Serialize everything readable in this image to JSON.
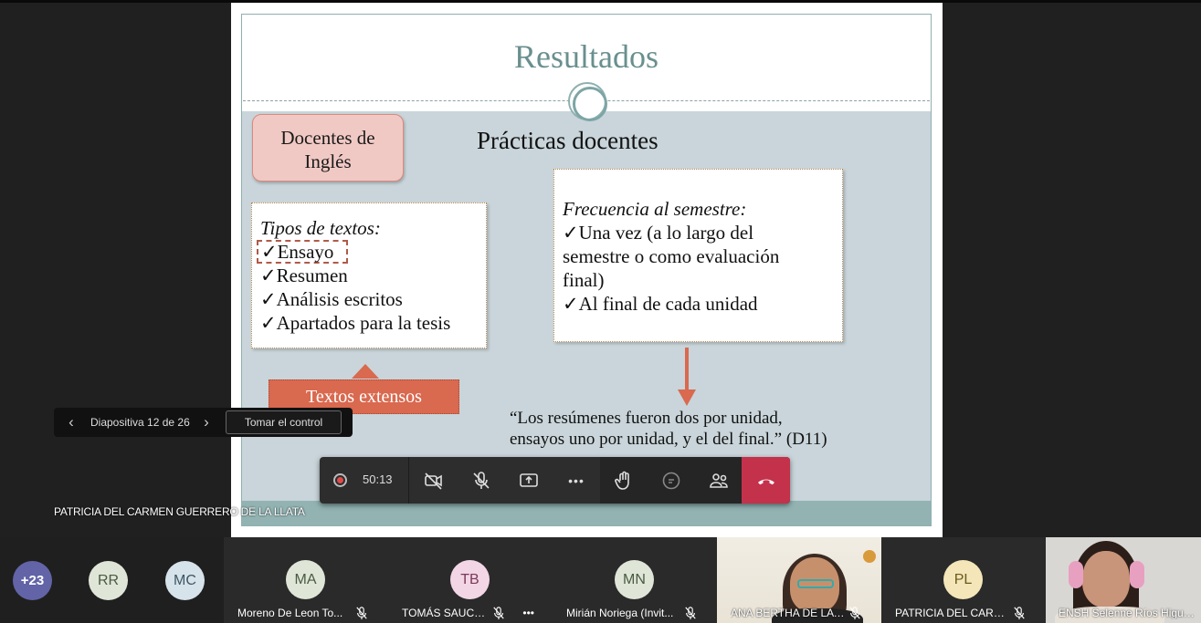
{
  "slide": {
    "title": "Resultados",
    "docentes_label_line1": "Docentes de",
    "docentes_label_line2": "Inglés",
    "practicas_title": "Prácticas docentes",
    "tipos": {
      "heading": "Tipos de textos:",
      "items": [
        "Ensayo",
        "Resumen",
        "Análisis escritos",
        "Apartados para la tesis"
      ]
    },
    "frecuencia": {
      "heading": "Frecuencia al semestre:",
      "item1_line1": "Una vez (a lo largo del",
      "item1_line2": "semestre o como evaluación",
      "item1_line3": "final)",
      "item2": "Al final de cada unidad"
    },
    "textos_extensos": "Textos extensos",
    "quote_line1": "“Los resúmenes fueron dos por unidad,",
    "quote_line2": "ensayos uno por unidad, y el del final.” (D11)",
    "check": "✓"
  },
  "slide_nav": {
    "prev_icon": "‹",
    "label": "Diapositiva 12 de 26",
    "next_icon": "›",
    "take_control": "Tomar el control"
  },
  "presenter_name": "PATRICIA DEL CARMEN GUERRERO DE LA LLATA",
  "controls": {
    "timer": "50:13",
    "more": "•••",
    "leave_color": "#c4314b",
    "record_color": "#e04a4a"
  },
  "participants": {
    "overflow": "+23",
    "avatars": [
      {
        "initials": "RR",
        "bg": "#dfe6d8",
        "fg": "#4a5a40"
      },
      {
        "initials": "MC",
        "bg": "#d7e3ea",
        "fg": "#3e5666"
      }
    ],
    "tiles": [
      {
        "initials": "MA",
        "name": "Moreno De Leon To...",
        "bg": "#dfe6d8",
        "fg": "#4a5a40"
      },
      {
        "initials": "TB",
        "name": "TOMÁS SAUCE...",
        "bg": "#f3d6e6",
        "fg": "#7a3a5a"
      },
      {
        "initials": "MN",
        "name": "Mirián Noriega (Invit...",
        "bg": "#dfe6d8",
        "fg": "#4a5a40"
      },
      {
        "initials": "PL",
        "name": "PATRICIA DEL CARM...",
        "bg": "#f4e6b8",
        "fg": "#6b5a1e"
      }
    ],
    "video_ana_name": "ANA BERTHA DE LA ...",
    "video_ensh_name": "ENSH Selenne Ríos Higuer..."
  }
}
